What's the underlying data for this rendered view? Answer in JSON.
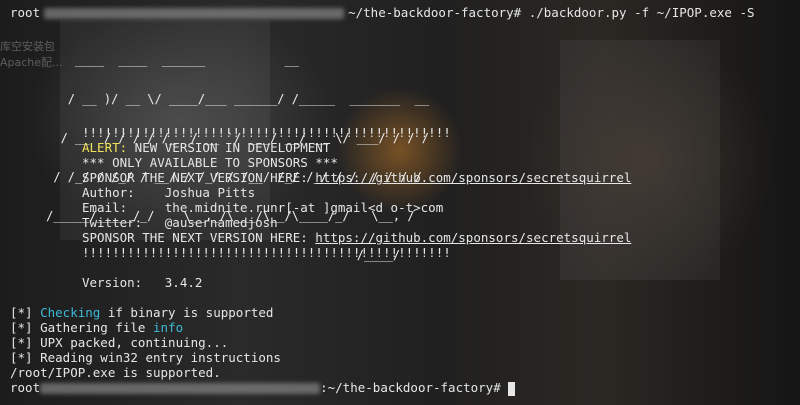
{
  "background_labels": {
    "label_a": "库空安装包",
    "label_b": "Apache配..."
  },
  "prompt_top": {
    "user": "root",
    "path_cmd": "~/the-backdoor-factory# ./backdoor.py -f ~/IPOP.exe -S"
  },
  "ascii_art": [
    "         ____  ____  ______           __",
    "        / __ )/ __ \\/ ____/___ ______/ /_____  _______  __",
    "       / __  / / / / /_  / __ `/ ___/ __/ __ \\/ ___/ / / /",
    "      / /_/ / /_/ / __/ / /_/ / /__/ /_/ /_/ / /  / /_/ /",
    "     /_____/_____/_/    \\__,_/\\___/\\__/\\____/_/   \\__, /",
    "                                                /____/"
  ],
  "banner": {
    "border": "!!!!!!!!!!!!!!!!!!!!!!!!!!!!!!!!!!!!!!!!!!!!!!!!!",
    "alert_label": "ALERT:",
    "alert_text": " NEW VERSION IN DEVELOPMENT",
    "sponsors_only": "*** ONLY AVAILABLE TO SPONSORS ***",
    "sponsor_text": "SPONSOR THE NEXT VERSION HERE: ",
    "sponsor_link": "https://github.com/sponsors/secretsquirrel",
    "author": "Author:    Joshua Pitts",
    "email": "Email:     the.midnite.runr[-at ]gmail<d o-t>com",
    "twitter": "Twitter:   @ausernamedjosh",
    "version": "Version:   3.4.2"
  },
  "log": {
    "line1_prefix": "[*] ",
    "line1_word": "Checking",
    "line1_rest": " if binary is supported",
    "line2_prefix": "[*] Gathering file ",
    "line2_word": "info",
    "line3": "[*] UPX packed, continuing...",
    "line4": "[*] Reading win32 entry instructions",
    "line5": "/root/IPOP.exe is supported."
  },
  "prompt_bottom": {
    "user": "root",
    "path": ":~/the-backdoor-factory# "
  },
  "colors": {
    "alert": "#f2e45a",
    "keyword": "#3db9d8",
    "text": "#e6e6e6"
  }
}
